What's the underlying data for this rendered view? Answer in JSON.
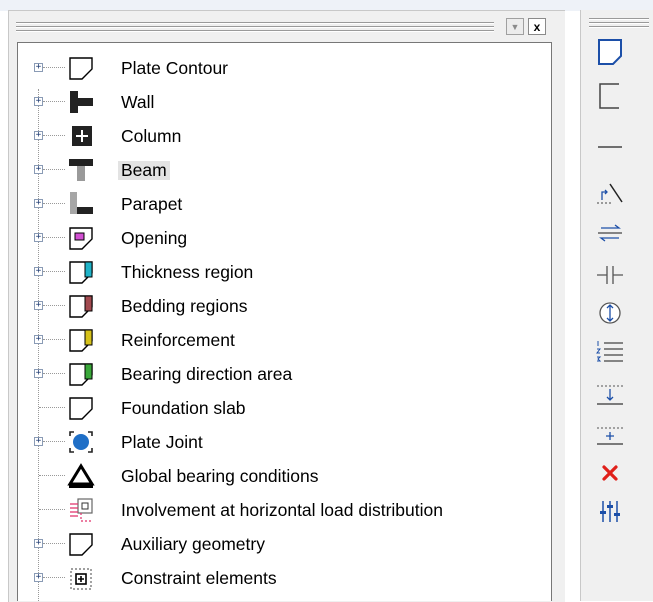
{
  "panel": {
    "toolbar": {
      "dropdown_glyph": "▼",
      "close_glyph": "x"
    },
    "tree": {
      "items": [
        {
          "label": "Plate Contour",
          "icon": "plate-contour-icon",
          "expandable": true
        },
        {
          "label": "Wall",
          "icon": "wall-icon",
          "expandable": true
        },
        {
          "label": "Column",
          "icon": "column-icon",
          "expandable": true
        },
        {
          "label": "Beam",
          "icon": "beam-icon",
          "expandable": true,
          "selected": true
        },
        {
          "label": "Parapet",
          "icon": "parapet-icon",
          "expandable": true
        },
        {
          "label": "Opening",
          "icon": "opening-icon",
          "expandable": true
        },
        {
          "label": "Thickness region",
          "icon": "thickness-region-icon",
          "expandable": true
        },
        {
          "label": "Bedding regions",
          "icon": "bedding-regions-icon",
          "expandable": true
        },
        {
          "label": "Reinforcement",
          "icon": "reinforcement-icon",
          "expandable": true
        },
        {
          "label": "Bearing direction area",
          "icon": "bearing-direction-area-icon",
          "expandable": true
        },
        {
          "label": "Foundation slab",
          "icon": "foundation-slab-icon",
          "expandable": false
        },
        {
          "label": "Plate Joint",
          "icon": "plate-joint-icon",
          "expandable": true
        },
        {
          "label": "Global bearing conditions",
          "icon": "global-bearing-conditions-icon",
          "expandable": false
        },
        {
          "label": "Involvement at horizontal load distribution",
          "icon": "involvement-load-distribution-icon",
          "expandable": false
        },
        {
          "label": "Auxiliary geometry",
          "icon": "auxiliary-geometry-icon",
          "expandable": true
        },
        {
          "label": "Constraint elements",
          "icon": "constraint-elements-icon",
          "expandable": true
        }
      ]
    }
  },
  "right_toolbar": {
    "buttons": [
      {
        "icon": "plate-outline-icon"
      },
      {
        "icon": "open-contour-icon"
      },
      {
        "icon": "line-icon"
      },
      {
        "icon": "angled-line-icon"
      },
      {
        "icon": "swap-direction-icon"
      },
      {
        "icon": "split-icon"
      },
      {
        "icon": "rotate-icon"
      },
      {
        "icon": "numbered-list-icon"
      },
      {
        "icon": "offset-down-icon"
      },
      {
        "icon": "insert-icon"
      },
      {
        "icon": "delete-icon"
      },
      {
        "icon": "settings-sliders-icon"
      }
    ]
  },
  "colors": {
    "thickness": "#1fb3c8",
    "bedding": "#a24a4f",
    "reinforcement": "#d6c21a",
    "bearing_direction": "#3aa83a",
    "opening": "#d24fd2",
    "plate_joint": "#1f6fc7",
    "accent_blue": "#1c4fa8",
    "delete_red": "#e0201a"
  }
}
